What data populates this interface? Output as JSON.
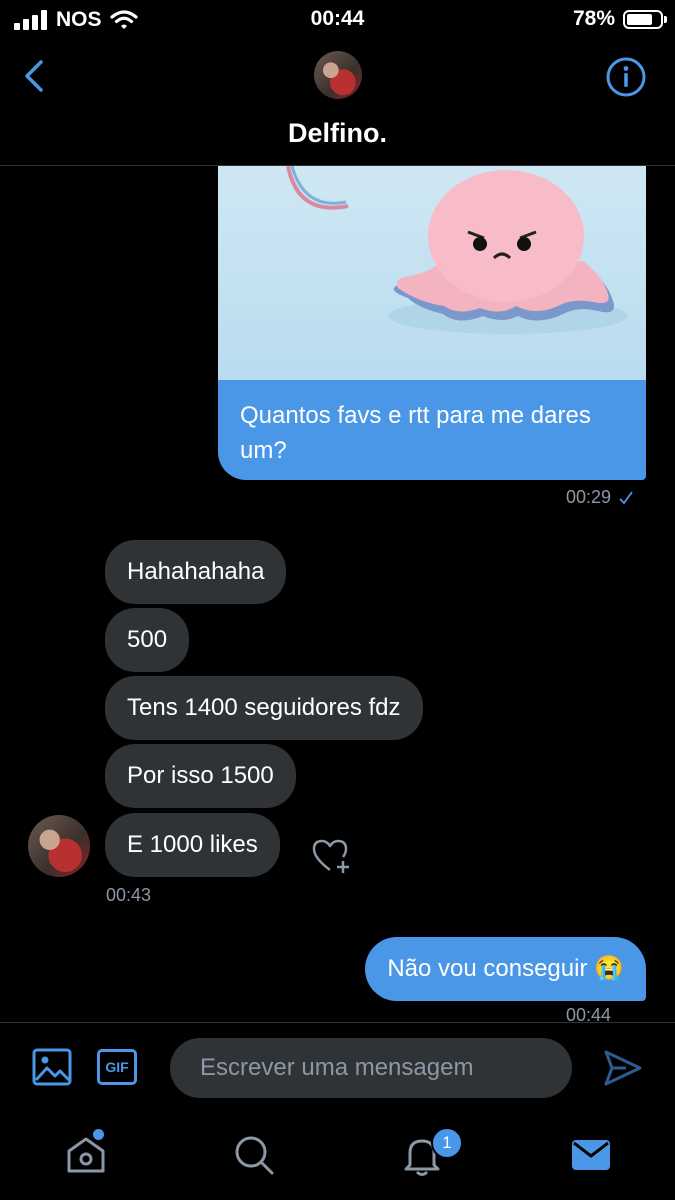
{
  "status_bar": {
    "carrier": "NOS",
    "time": "00:44",
    "battery": "78%"
  },
  "header": {
    "name": "Delfino."
  },
  "messages": {
    "sent_media": {
      "text": "Quantos favs e rtt para me dares um?",
      "time": "00:29"
    },
    "received": [
      "Hahahahaha",
      "500",
      "Tens 1400 seguidores fdz",
      "Por isso 1500",
      "E 1000 likes"
    ],
    "received_time": "00:43",
    "sent_last": {
      "text": "Não vou conseguir 😭",
      "time": "00:44"
    }
  },
  "composer": {
    "placeholder": "Escrever uma mensagem",
    "gif_label": "GIF"
  },
  "tabbar": {
    "notifications_badge": "1"
  },
  "colors": {
    "accent": "#4a97e8",
    "incoming_bubble": "#2f3336",
    "background": "#000000"
  },
  "icons": [
    "back-icon",
    "info-icon",
    "heart-plus-icon",
    "image-icon",
    "gif-icon",
    "send-icon",
    "home-icon",
    "search-icon",
    "bell-icon",
    "mail-icon"
  ]
}
